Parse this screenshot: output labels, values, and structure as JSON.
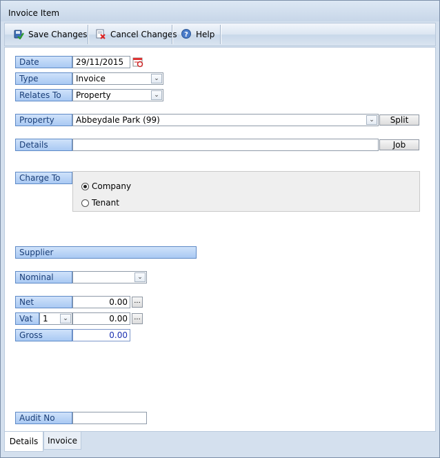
{
  "window": {
    "title": "Invoice Item"
  },
  "toolbar": {
    "save_label": "Save Changes",
    "cancel_label": "Cancel Changes",
    "help_label": "Help"
  },
  "form": {
    "date": {
      "label": "Date",
      "value": "29/11/2015"
    },
    "type": {
      "label": "Type",
      "value": "Invoice"
    },
    "relates_to": {
      "label": "Relates To",
      "value": "Property"
    },
    "property": {
      "label": "Property",
      "value": "Abbeydale Park (99)",
      "split_label": "Split"
    },
    "details": {
      "label": "Details",
      "value": "",
      "job_label": "Job"
    },
    "charge_to": {
      "label": "Charge To",
      "options": [
        "Company",
        "Tenant"
      ],
      "selected": "Company"
    },
    "supplier": {
      "label": "Supplier"
    },
    "nominal": {
      "label": "Nominal",
      "value": ""
    },
    "net": {
      "label": "Net",
      "value": "0.00",
      "ellipsis": "..."
    },
    "vat": {
      "label": "Vat",
      "rate": "1",
      "value": "0.00",
      "ellipsis": "..."
    },
    "gross": {
      "label": "Gross",
      "value": "0.00"
    },
    "audit_no": {
      "label": "Audit No",
      "value": ""
    }
  },
  "tabs": [
    {
      "label": "Details",
      "active": true
    },
    {
      "label": "Invoice",
      "active": false
    }
  ],
  "icons": {
    "save": "save-icon",
    "cancel": "cancel-icon",
    "help": "help-icon",
    "calendar": "calendar-icon",
    "dropdown": "chevron-down-icon"
  },
  "colors": {
    "label_bg": "#b7d2f6",
    "label_border": "#5d89c6",
    "label_text": "#1a3e78",
    "gross_value": "#1a2fb0"
  }
}
